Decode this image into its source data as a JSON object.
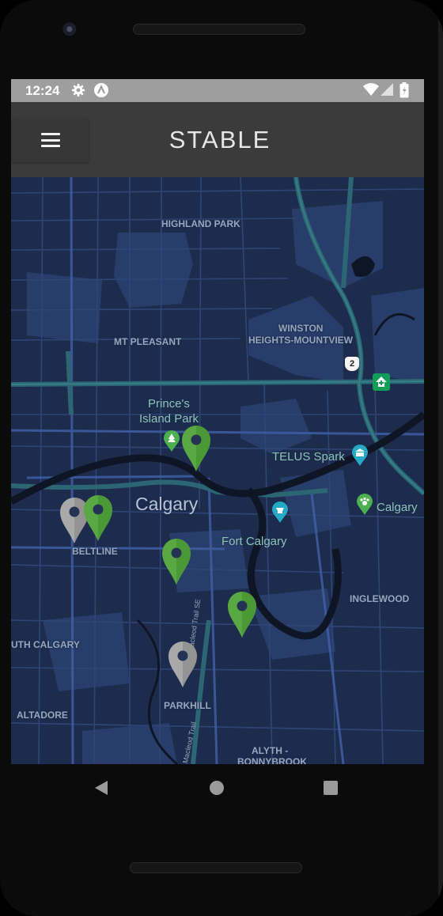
{
  "status_bar": {
    "time": "12:24",
    "icons": [
      "gear-icon",
      "app-a-icon",
      "wifi-icon",
      "signal-icon",
      "battery-icon"
    ]
  },
  "app_bar": {
    "title": "STABLE",
    "menu_icon": "hamburger-menu-icon"
  },
  "map": {
    "neighbourhood_labels": [
      "HIGHLAND PARK",
      "MT PLEASANT",
      "WINSTON",
      "HEIGHTS-MOUNTVIEW",
      "BELTLINE",
      "INGLEWOOD",
      "UTH CALGARY",
      "ALTADORE",
      "PARKHILL",
      "ALYTH -",
      "BONNYBROOK"
    ],
    "city_label": "Calgary",
    "poi_labels": [
      "Prince's",
      "Island Park",
      "TELUS Spark",
      "Calgary",
      "Fort Calgary"
    ],
    "road_labels": [
      "Macleod Trail SE",
      "Macleod Trail"
    ],
    "highway_shield": "2",
    "markers": [
      {
        "id": "marker-1",
        "status": "active",
        "color": "#5aa844"
      },
      {
        "id": "marker-2",
        "status": "inactive",
        "color": "#a9a9a9"
      },
      {
        "id": "marker-3",
        "status": "active",
        "color": "#5aa844"
      },
      {
        "id": "marker-4",
        "status": "active",
        "color": "#5aa844"
      },
      {
        "id": "marker-5",
        "status": "active",
        "color": "#5aa844"
      },
      {
        "id": "marker-6",
        "status": "inactive",
        "color": "#a9a9a9"
      }
    ],
    "colors": {
      "land": "#1d2c4d",
      "parks": "#283d6a",
      "roads": "#304a7d",
      "highways": "#2c6675",
      "river": "#0e1626"
    }
  },
  "nav_bar": {
    "buttons": [
      "back-icon",
      "home-icon",
      "recents-icon"
    ]
  }
}
